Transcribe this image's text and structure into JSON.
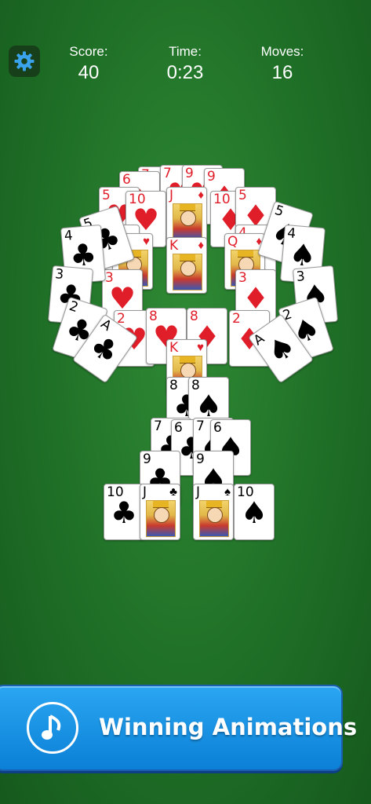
{
  "header": {
    "score_label": "Score:",
    "score_value": "40",
    "time_label": "Time:",
    "time_value": "0:23",
    "moves_label": "Moves:",
    "moves_value": "16",
    "settings_icon": "gear-icon"
  },
  "trophy_cards": [
    {
      "rank": "7",
      "suit": "♦",
      "color": "red",
      "face": false
    },
    {
      "rank": "6",
      "suit": "♦",
      "color": "red",
      "face": false
    },
    {
      "rank": "7",
      "suit": "♥",
      "color": "red",
      "face": false
    },
    {
      "rank": "9",
      "suit": "♥",
      "color": "red",
      "face": false
    },
    {
      "rank": "9",
      "suit": "♦",
      "color": "red",
      "face": false
    },
    {
      "rank": "5",
      "suit": "♥",
      "color": "red",
      "face": false
    },
    {
      "rank": "10",
      "suit": "♥",
      "color": "red",
      "face": false
    },
    {
      "rank": "J",
      "suit": "♦",
      "color": "red",
      "face": true
    },
    {
      "rank": "10",
      "suit": "♦",
      "color": "red",
      "face": false
    },
    {
      "rank": "5",
      "suit": "♦",
      "color": "red",
      "face": false
    },
    {
      "rank": "4",
      "suit": "♥",
      "color": "red",
      "face": false
    },
    {
      "rank": "4",
      "suit": "♦",
      "color": "red",
      "face": false
    },
    {
      "rank": "Q",
      "suit": "♥",
      "color": "red",
      "face": true
    },
    {
      "rank": "K",
      "suit": "♦",
      "color": "red",
      "face": true
    },
    {
      "rank": "Q",
      "suit": "♦",
      "color": "red",
      "face": true
    },
    {
      "rank": "3",
      "suit": "♥",
      "color": "red",
      "face": false
    },
    {
      "rank": "3",
      "suit": "♦",
      "color": "red",
      "face": false
    },
    {
      "rank": "2",
      "suit": "♥",
      "color": "red",
      "face": false
    },
    {
      "rank": "2",
      "suit": "♦",
      "color": "red",
      "face": false
    },
    {
      "rank": "8",
      "suit": "♥",
      "color": "red",
      "face": false
    },
    {
      "rank": "8",
      "suit": "♦",
      "color": "red",
      "face": false
    },
    {
      "rank": "K",
      "suit": "♥",
      "color": "red",
      "face": true
    },
    {
      "rank": "5",
      "suit": "♣",
      "color": "black",
      "face": false
    },
    {
      "rank": "4",
      "suit": "♣",
      "color": "black",
      "face": false
    },
    {
      "rank": "3",
      "suit": "♣",
      "color": "black",
      "face": false
    },
    {
      "rank": "2",
      "suit": "♣",
      "color": "black",
      "face": false
    },
    {
      "rank": "A",
      "suit": "♣",
      "color": "black",
      "face": false
    },
    {
      "rank": "5",
      "suit": "♠",
      "color": "black",
      "face": false
    },
    {
      "rank": "4",
      "suit": "♠",
      "color": "black",
      "face": false
    },
    {
      "rank": "3",
      "suit": "♠",
      "color": "black",
      "face": false
    },
    {
      "rank": "2",
      "suit": "♠",
      "color": "black",
      "face": false
    },
    {
      "rank": "A",
      "suit": "♠",
      "color": "black",
      "face": false
    },
    {
      "rank": "8",
      "suit": "♣",
      "color": "black",
      "face": false
    },
    {
      "rank": "8",
      "suit": "♠",
      "color": "black",
      "face": false
    },
    {
      "rank": "7",
      "suit": "♣",
      "color": "black",
      "face": false
    },
    {
      "rank": "6",
      "suit": "♣",
      "color": "black",
      "face": false
    },
    {
      "rank": "7",
      "suit": "♠",
      "color": "black",
      "face": false
    },
    {
      "rank": "6",
      "suit": "♠",
      "color": "black",
      "face": false
    },
    {
      "rank": "9",
      "suit": "♣",
      "color": "black",
      "face": false
    },
    {
      "rank": "9",
      "suit": "♠",
      "color": "black",
      "face": false
    },
    {
      "rank": "10",
      "suit": "♣",
      "color": "black",
      "face": false
    },
    {
      "rank": "J",
      "suit": "♣",
      "color": "black",
      "face": true
    },
    {
      "rank": "J",
      "suit": "♠",
      "color": "black",
      "face": true
    },
    {
      "rank": "10",
      "suit": "♠",
      "color": "black",
      "face": false
    }
  ],
  "banner": {
    "label": "Winning Animations",
    "icon": "music-note-icon"
  },
  "colors": {
    "felt": "#1f6f27",
    "banner_blue": "#1a90e0",
    "red_suit": "#e01e2a"
  }
}
